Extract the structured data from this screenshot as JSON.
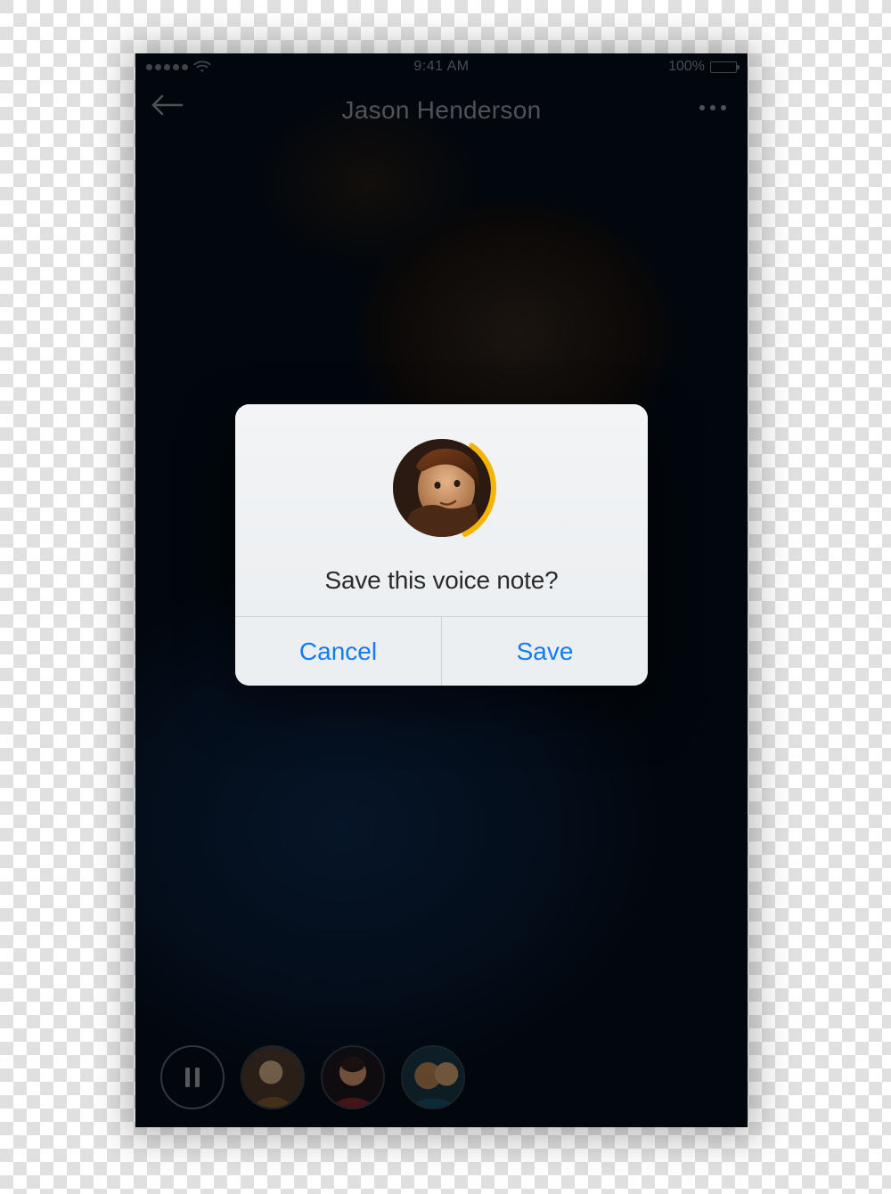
{
  "status_bar": {
    "time": "9:41 AM",
    "battery_label": "100%"
  },
  "nav": {
    "title": "Jason Henderson"
  },
  "modal": {
    "message": "Save this voice note?",
    "cancel_label": "Cancel",
    "save_label": "Save",
    "accent_color": "#f5b400",
    "button_color": "#147cf0"
  },
  "icons": {
    "back": "back-arrow-icon",
    "more": "more-icon",
    "pause": "pause-icon",
    "wifi": "wifi-icon"
  }
}
